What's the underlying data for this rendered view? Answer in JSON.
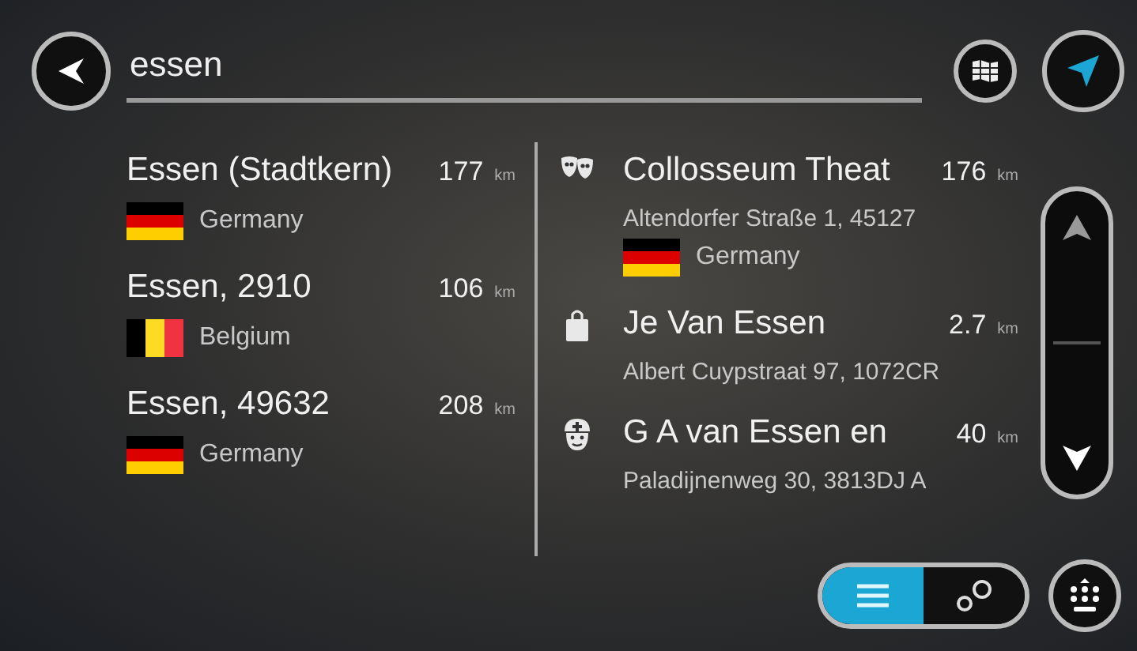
{
  "search": {
    "value": "essen"
  },
  "places": [
    {
      "name": "Essen (Stadtkern)",
      "distance": "177",
      "unit": "km",
      "country": "Germany",
      "flag": {
        "kind": "de"
      }
    },
    {
      "name": "Essen, 2910",
      "distance": "106",
      "unit": "km",
      "country": "Belgium",
      "flag": {
        "kind": "be"
      }
    },
    {
      "name": "Essen, 49632",
      "distance": "208",
      "unit": "km",
      "country": "Germany",
      "flag": {
        "kind": "de"
      }
    }
  ],
  "pois": [
    {
      "kind": "theatre",
      "name": "Collosseum Theat",
      "distance": "176",
      "unit": "km",
      "address": "Altendorfer Straße 1, 45127",
      "country": "Germany",
      "flag": {
        "kind": "de"
      }
    },
    {
      "kind": "shop",
      "name": "Je Van Essen",
      "distance": "2.7",
      "unit": "km",
      "address": "Albert Cuypstraat 97, 1072CR"
    },
    {
      "kind": "doctor",
      "name": "G A van Essen en",
      "distance": "40",
      "unit": "km",
      "address": "Paladijnenweg 30, 3813DJ A"
    }
  ],
  "view_toggle": [
    {
      "kind": "list",
      "selected": true
    },
    {
      "kind": "map",
      "selected": false
    }
  ]
}
